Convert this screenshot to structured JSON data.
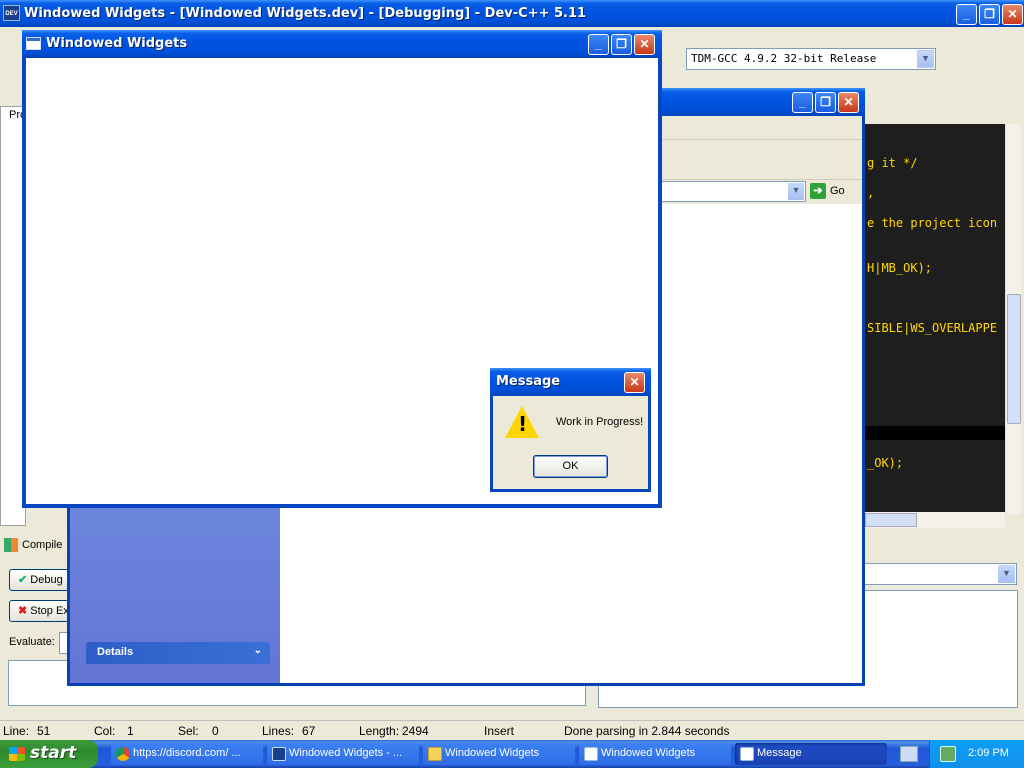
{
  "devcpp": {
    "title": "Windowed Widgets - [Windowed Widgets.dev] - [Debugging] - Dev-C++ 5.11",
    "compiler": "TDM-GCC 4.9.2 32-bit Release",
    "left_tab": "Pro",
    "code_lines": [
      "g it */",
      "",
      ",",
      "e the project icon",
      "",
      "H|MB_OK);",
      "",
      "",
      "SIBLE|WS_OVERLAPPE",
      "",
      "",
      "",
      "",
      "_OK);"
    ],
    "bottom_tab": "Compile",
    "debug_button": "Debug",
    "stop_button": "Stop Execution",
    "evaluate_label": "Evaluate:"
  },
  "status": {
    "line_label": "Line:",
    "line_value": "51",
    "col_label": "Col:",
    "col_value": "1",
    "sel_label": "Sel:",
    "sel_value": "0",
    "lines_label": "Lines:",
    "lines_value": "67",
    "length_label": "Length:",
    "length_value": "2494",
    "mode": "Insert",
    "message": "Done parsing in 2.844 seconds"
  },
  "explorer": {
    "go_label": "Go",
    "details_label": "Details"
  },
  "app_window": {
    "title": "Windowed Widgets"
  },
  "message_box": {
    "title": "Message",
    "text": "Work in Progress!",
    "ok_label": "OK"
  },
  "taskbar": {
    "start_label": "start",
    "items": [
      {
        "label": "https://discord.com/ ..."
      },
      {
        "label": "Windowed Widgets - ..."
      },
      {
        "label": "Windowed Widgets"
      },
      {
        "label": "Windowed Widgets"
      },
      {
        "label": "Message"
      }
    ],
    "clock": "2:09 PM"
  }
}
